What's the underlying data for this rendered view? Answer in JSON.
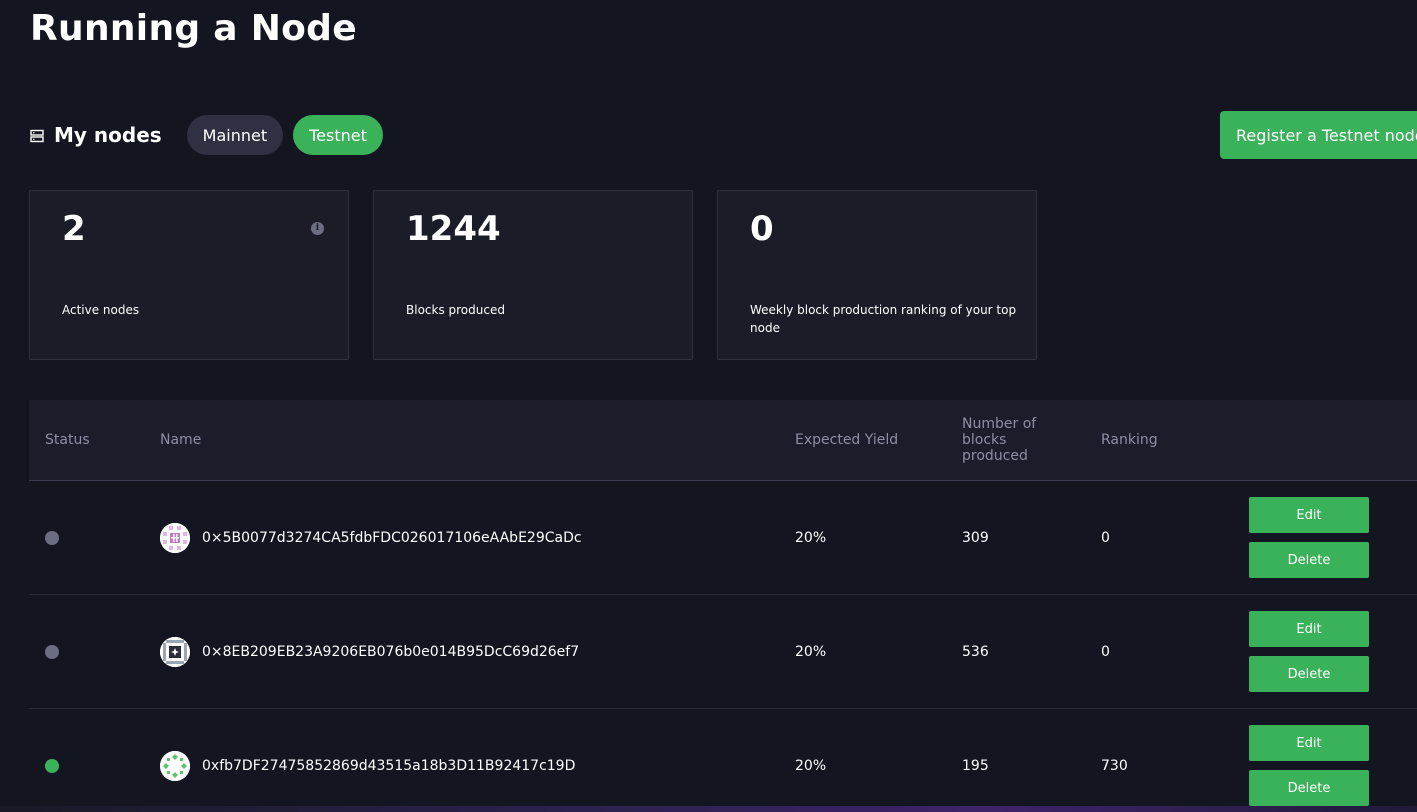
{
  "page": {
    "title": "Running a Node"
  },
  "nodes_section": {
    "title": "My nodes",
    "icon": "server-icon",
    "tabs": [
      {
        "label": "Mainnet",
        "active": false
      },
      {
        "label": "Testnet",
        "active": true
      }
    ],
    "register_label": "Register a Testnet node"
  },
  "stats": [
    {
      "value": "2",
      "label": "Active nodes",
      "has_info": true
    },
    {
      "value": "1244",
      "label": "Blocks produced"
    },
    {
      "value": "0",
      "label": "Weekly block production ranking of your top node"
    }
  ],
  "table": {
    "headers": {
      "status": "Status",
      "name": "Name",
      "yield": "Expected Yield",
      "blocks": "Number of blocks produced",
      "ranking": "Ranking"
    },
    "edit_label": "Edit",
    "delete_label": "Delete",
    "rows": [
      {
        "status": "inactive",
        "name": "0×5B0077d3274CA5fdbFDC026017106eAAbE29CaDc",
        "yield": "20%",
        "blocks": "309",
        "ranking": "0"
      },
      {
        "status": "inactive",
        "name": "0×8EB209EB23A9206EB076b0e014B95DcC69d26ef7",
        "yield": "20%",
        "blocks": "536",
        "ranking": "0"
      },
      {
        "status": "active",
        "name": "0xfb7DF27475852869d43515a18b3D11B92417c19D",
        "yield": "20%",
        "blocks": "195",
        "ranking": "730"
      }
    ]
  },
  "colors": {
    "background": "#131521",
    "accent_green": "#3ab25a",
    "status_inactive": "#6b6e80",
    "status_active": "#3ab25a"
  }
}
